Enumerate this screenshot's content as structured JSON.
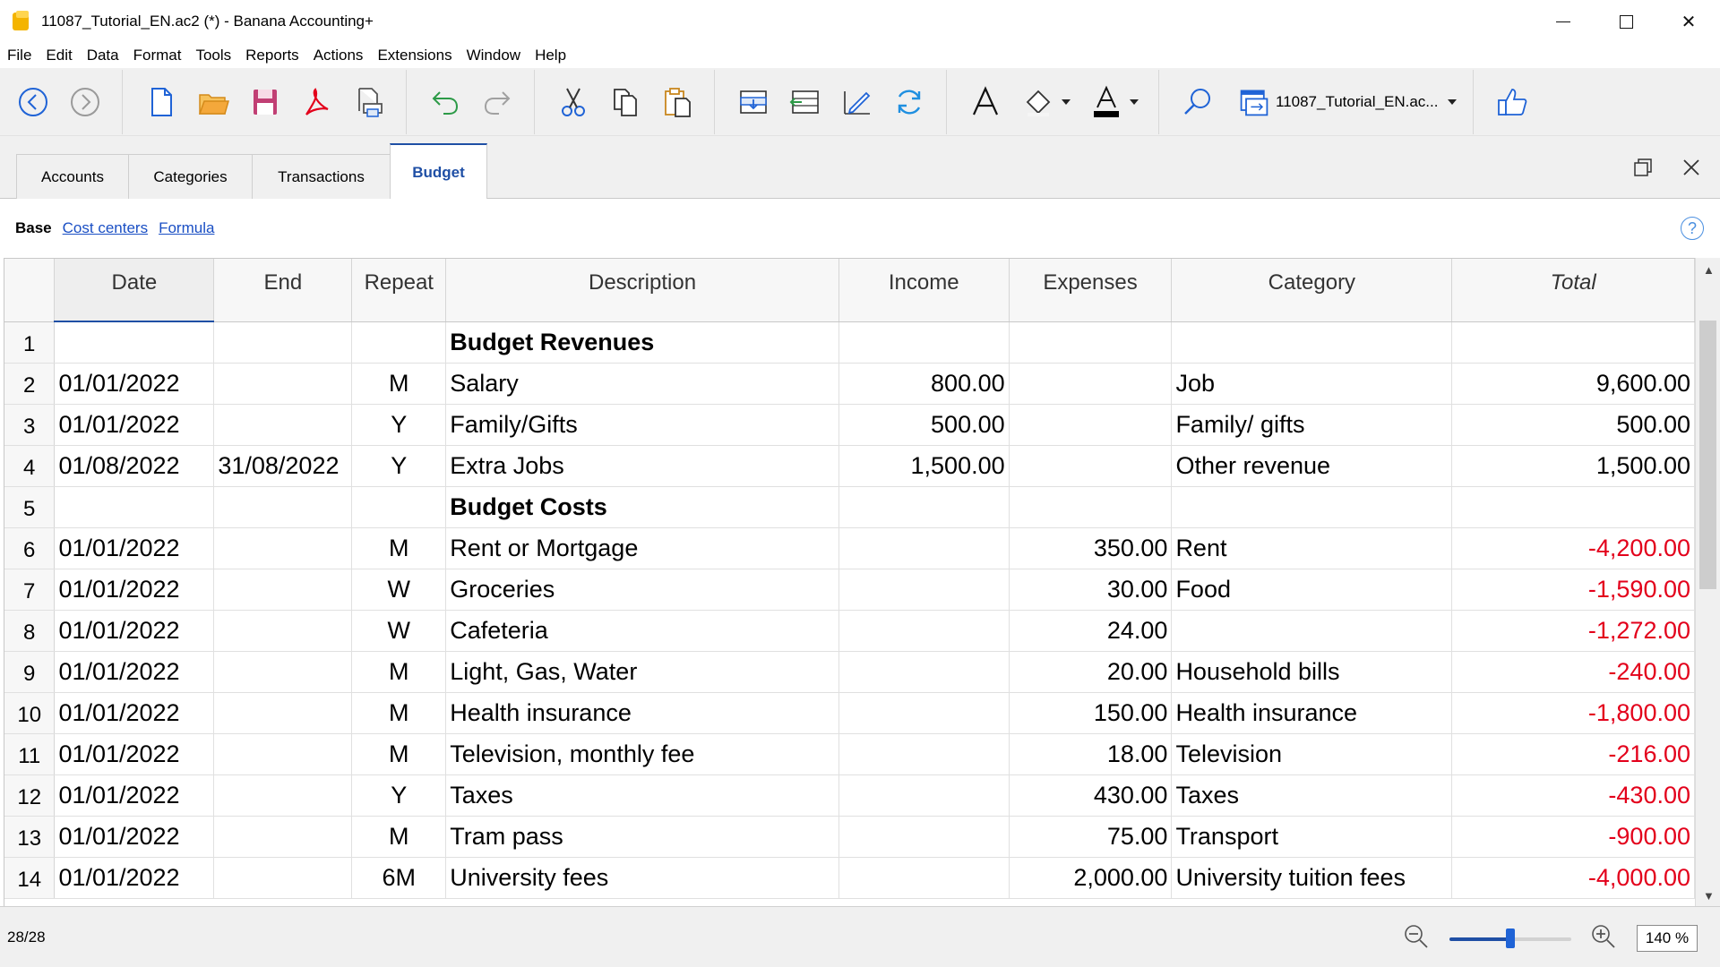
{
  "window": {
    "title": "11087_Tutorial_EN.ac2 (*) - Banana Accounting+"
  },
  "menu": [
    "File",
    "Edit",
    "Data",
    "Format",
    "Tools",
    "Reports",
    "Actions",
    "Extensions",
    "Window",
    "Help"
  ],
  "toolbar": {
    "buttons": [
      "back-icon",
      "forward-icon",
      "new-file-icon",
      "open-folder-icon",
      "save-icon",
      "pdf-icon",
      "print-preview-icon",
      "undo-icon",
      "redo-icon",
      "cut-icon",
      "copy-icon",
      "paste-icon",
      "insert-rows-icon",
      "move-rows-icon",
      "edit-icon",
      "recalculate-icon",
      "font-icon",
      "fill-color-icon",
      "text-color-icon",
      "search-icon",
      "window-icon",
      "like-icon"
    ],
    "document_selector": "11087_Tutorial_EN.ac..."
  },
  "tabs": [
    "Accounts",
    "Categories",
    "Transactions",
    "Budget"
  ],
  "active_tab": "Budget",
  "subviews": {
    "base": "Base",
    "links": [
      "Cost centers",
      "Formula"
    ]
  },
  "table": {
    "columns": [
      "Date",
      "End",
      "Repeat",
      "Description",
      "Income",
      "Expenses",
      "Category",
      "Total"
    ],
    "rows": [
      {
        "n": "1",
        "date": "",
        "end": "",
        "repeat": "",
        "description": "Budget Revenues",
        "income": "",
        "expenses": "",
        "category": "",
        "total": "",
        "heading": true
      },
      {
        "n": "2",
        "date": "01/01/2022",
        "end": "",
        "repeat": "M",
        "description": "Salary",
        "income": "800.00",
        "expenses": "",
        "category": "Job",
        "total": "9,600.00"
      },
      {
        "n": "3",
        "date": "01/01/2022",
        "end": "",
        "repeat": "Y",
        "description": "Family/Gifts",
        "income": "500.00",
        "expenses": "",
        "category": "Family/ gifts",
        "total": "500.00"
      },
      {
        "n": "4",
        "date": "01/08/2022",
        "end": "31/08/2022",
        "repeat": "Y",
        "description": "Extra Jobs",
        "income": "1,500.00",
        "expenses": "",
        "category": "Other revenue",
        "total": "1,500.00"
      },
      {
        "n": "5",
        "date": "",
        "end": "",
        "repeat": "",
        "description": "Budget Costs",
        "income": "",
        "expenses": "",
        "category": "",
        "total": "",
        "heading": true
      },
      {
        "n": "6",
        "date": "01/01/2022",
        "end": "",
        "repeat": "M",
        "description": "Rent or Mortgage",
        "income": "",
        "expenses": "350.00",
        "category": "Rent",
        "total": "-4,200.00"
      },
      {
        "n": "7",
        "date": "01/01/2022",
        "end": "",
        "repeat": "W",
        "description": "Groceries",
        "income": "",
        "expenses": "30.00",
        "category": "Food",
        "total": "-1,590.00"
      },
      {
        "n": "8",
        "date": "01/01/2022",
        "end": "",
        "repeat": "W",
        "description": "Cafeteria",
        "income": "",
        "expenses": "24.00",
        "category": "",
        "total": "-1,272.00"
      },
      {
        "n": "9",
        "date": "01/01/2022",
        "end": "",
        "repeat": "M",
        "description": "Light, Gas, Water",
        "income": "",
        "expenses": "20.00",
        "category": "Household bills",
        "total": "-240.00"
      },
      {
        "n": "10",
        "date": "01/01/2022",
        "end": "",
        "repeat": "M",
        "description": "Health insurance",
        "income": "",
        "expenses": "150.00",
        "category": "Health insurance",
        "total": "-1,800.00"
      },
      {
        "n": "11",
        "date": "01/01/2022",
        "end": "",
        "repeat": "M",
        "description": "Television, monthly fee",
        "income": "",
        "expenses": "18.00",
        "category": "Television",
        "total": "-216.00"
      },
      {
        "n": "12",
        "date": "01/01/2022",
        "end": "",
        "repeat": "Y",
        "description": "Taxes",
        "income": "",
        "expenses": "430.00",
        "category": "Taxes",
        "total": "-430.00"
      },
      {
        "n": "13",
        "date": "01/01/2022",
        "end": "",
        "repeat": "M",
        "description": "Tram pass",
        "income": "",
        "expenses": "75.00",
        "category": "Transport",
        "total": "-900.00"
      },
      {
        "n": "14",
        "date": "01/01/2022",
        "end": "",
        "repeat": "6M",
        "description": "University fees",
        "income": "",
        "expenses": "2,000.00",
        "category": "University tuition fees",
        "total": "-4,000.00"
      }
    ]
  },
  "status": {
    "row_count": "28/28",
    "zoom": "140 %",
    "zoom_level_fraction": 0.5
  },
  "colors": {
    "accent": "#1f4fa5",
    "negative": "#e3001b",
    "link": "#1a4fc4"
  }
}
